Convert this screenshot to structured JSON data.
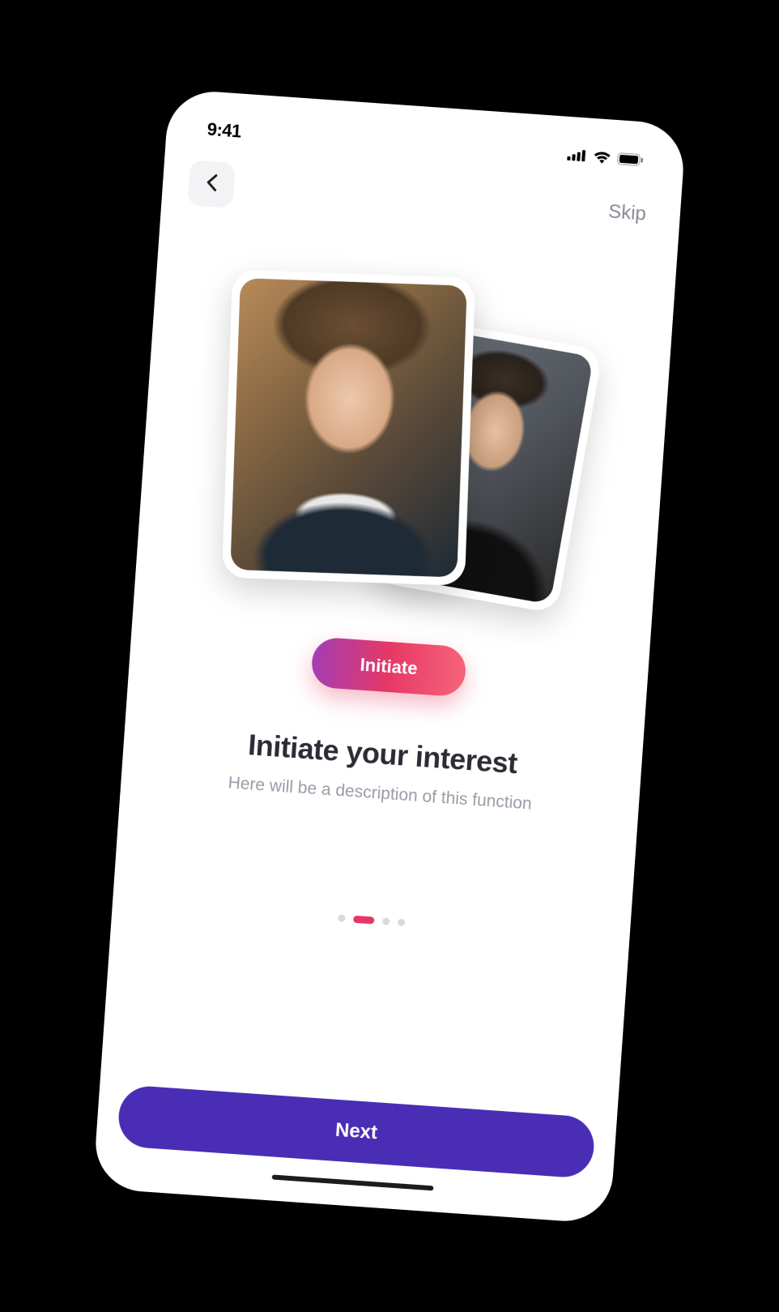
{
  "status": {
    "time": "9:41"
  },
  "nav": {
    "skip_label": "Skip"
  },
  "hero": {
    "photo_left": "profile-photo-male",
    "photo_right": "profile-photo-female"
  },
  "cta": {
    "initiate_label": "Initiate"
  },
  "content": {
    "title": "Initiate your interest",
    "subtitle": "Here will be a description of this function"
  },
  "pager": {
    "count": 4,
    "active_index": 1
  },
  "footer": {
    "next_label": "Next"
  },
  "colors": {
    "accent_gradient_start": "#a33db5",
    "accent_gradient_end": "#f7647a",
    "primary": "#4a2db5",
    "dot_active": "#e63865"
  }
}
